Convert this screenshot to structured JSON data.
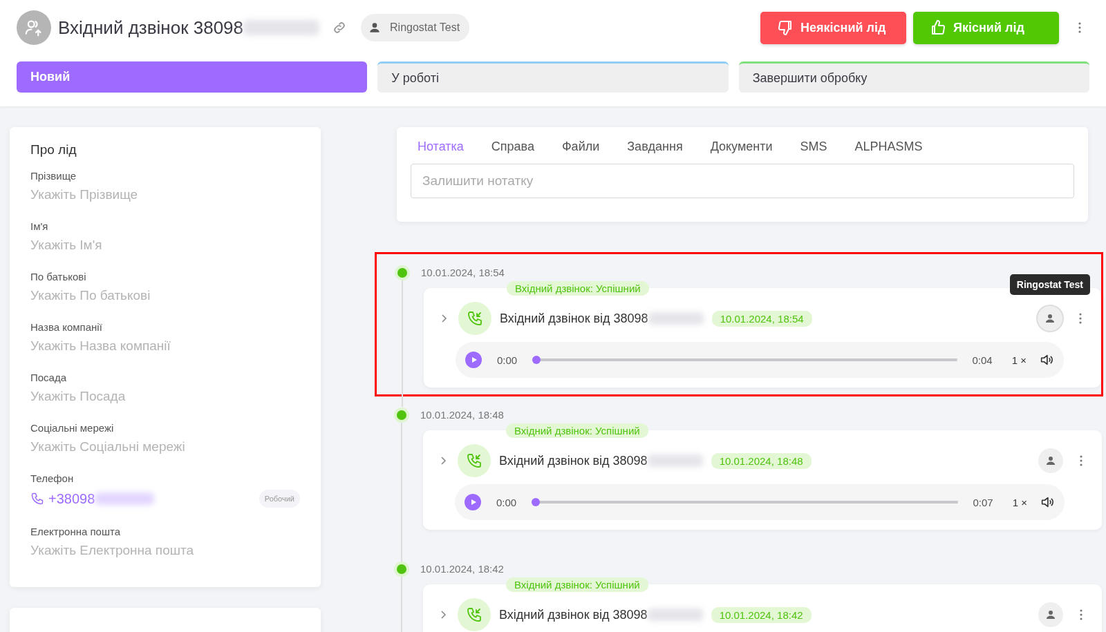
{
  "header": {
    "title": "Вхідний дзвінок 38098",
    "owner": "Ringostat Test",
    "buttons": [
      {
        "kind": "bad",
        "label": "Неякісний лід"
      },
      {
        "kind": "good",
        "label": "Якісний лід"
      }
    ]
  },
  "steps": [
    {
      "label": "Новий",
      "selected": true,
      "color": "#9d6bff"
    },
    {
      "label": "У роботі",
      "selected": false,
      "color": "#8fcdf5"
    },
    {
      "label": "Завершити обробку",
      "selected": false,
      "color": "#7ee07a"
    }
  ],
  "about": {
    "title": "Про лід",
    "fields": [
      {
        "kind": "text",
        "label": "Прізвище",
        "placeholder": "Укажіть Прізвище"
      },
      {
        "kind": "text",
        "label": "Ім'я",
        "placeholder": "Укажіть Ім'я"
      },
      {
        "kind": "text",
        "label": "По батькові",
        "placeholder": "Укажіть По батькові"
      },
      {
        "kind": "text",
        "label": "Назва компанії",
        "placeholder": "Укажіть Назва компанії"
      },
      {
        "kind": "text",
        "label": "Посада",
        "placeholder": "Укажіть Посада"
      },
      {
        "kind": "text",
        "label": "Соціальні мережі",
        "placeholder": "Укажіть Соціальні мережі"
      },
      {
        "kind": "phone",
        "label": "Телефон",
        "value": "+38098",
        "tag": "Робочий"
      },
      {
        "kind": "text",
        "label": "Електронна пошта",
        "placeholder": "Укажіть Електронна пошта"
      }
    ]
  },
  "tabs": [
    {
      "label": "Нотатка",
      "selected": true
    },
    {
      "label": "Справа",
      "selected": false
    },
    {
      "label": "Файли",
      "selected": false
    },
    {
      "label": "Завдання",
      "selected": false
    },
    {
      "label": "Документи",
      "selected": false
    },
    {
      "label": "SMS",
      "selected": false
    },
    {
      "label": "ALPHASMS",
      "selected": false
    }
  ],
  "note": {
    "placeholder": "Залишити нотатку"
  },
  "events": [
    {
      "date": "10.01.2024, 18:54",
      "status": "Вхідний дзвінок: Успішний",
      "title": "Вхідний дзвінок від 38098",
      "time": "10.01.2024, 18:54",
      "highlighted": true,
      "tooltip": "Ringostat Test",
      "player": {
        "current": "0:00",
        "duration": "0:04",
        "speed": "1 ×",
        "level": 0
      }
    },
    {
      "date": "10.01.2024, 18:48",
      "status": "Вхідний дзвінок: Успішний",
      "title": "Вхідний дзвінок від 38098",
      "time": "10.01.2024, 18:48",
      "highlighted": false,
      "player": {
        "current": "0:00",
        "duration": "0:07",
        "speed": "1 ×",
        "level": 0
      }
    },
    {
      "date": "10.01.2024, 18:42",
      "status": "Вхідний дзвінок: Успішний",
      "title": "Вхідний дзвінок від 38098",
      "time": "10.01.2024, 18:42",
      "highlighted": false
    }
  ]
}
